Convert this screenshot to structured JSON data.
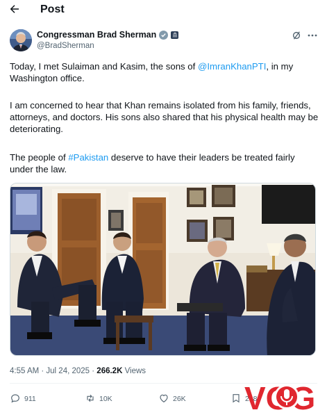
{
  "header": {
    "title": "Post"
  },
  "author": {
    "name": "Congressman Brad Sherman",
    "handle": "@BradSherman"
  },
  "post": {
    "p1_a": "Today, I met Sulaiman and Kasim, the sons of ",
    "p1_link": "@ImranKhanPTI",
    "p1_b": ", in my Washington office.",
    "p2": "I am concerned to hear that Khan remains isolated from his family, friends, attorneys, and doctors. His sons also shared that his physical health may be deteriorating.",
    "p3_a": "The people of ",
    "p3_link": "#Pakistan",
    "p3_b": " deserve to have their leaders be treated fairly under the law."
  },
  "meta": {
    "time": "4:55 AM · Jul 24, 2025 · ",
    "views_count": "266.2K",
    "views_label": " Views"
  },
  "actions": {
    "replies": "911",
    "reposts": "10K",
    "likes": "26K",
    "bookmarks": "218"
  },
  "watermark": {
    "text": "VOG"
  },
  "colors": {
    "link": "#1d9bf0",
    "text": "#0f1419",
    "muted": "#536471",
    "watermark_red": "#e0272f"
  },
  "icons": {
    "back": "arrow-left-icon",
    "verified": "verified-badge-icon",
    "government": "government-badge-icon",
    "grok": "grok-icon",
    "more": "more-icon",
    "reply": "reply-icon",
    "repost": "repost-icon",
    "like": "heart-icon",
    "bookmark": "bookmark-icon"
  }
}
